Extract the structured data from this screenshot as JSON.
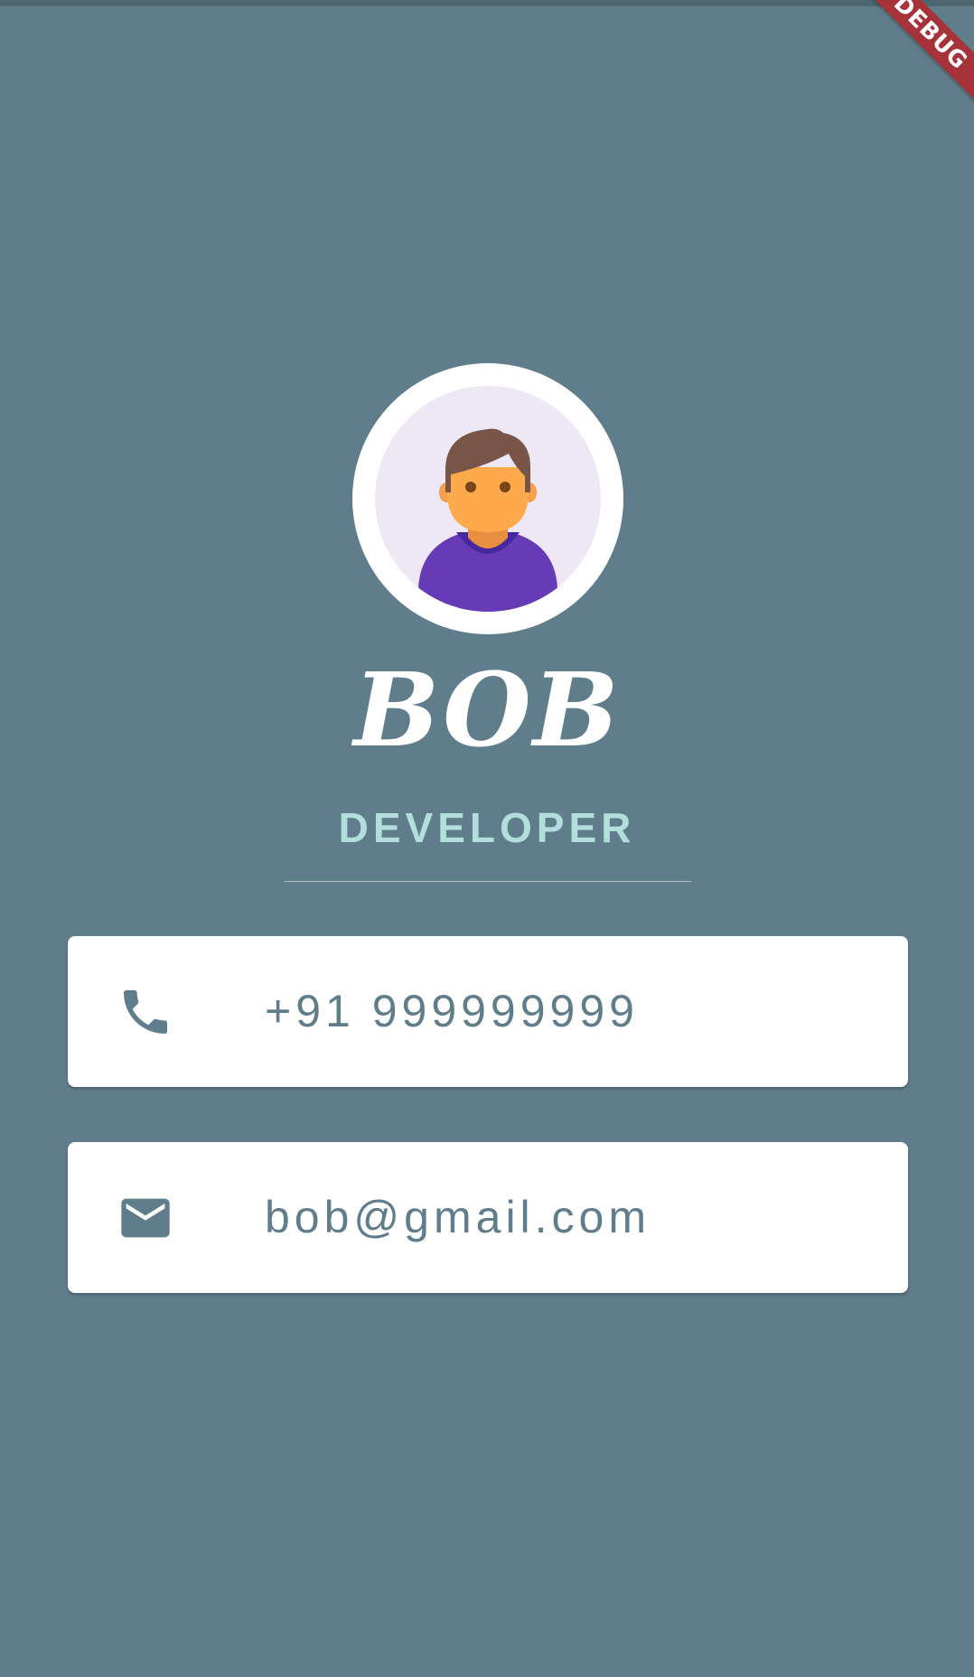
{
  "debug_banner": {
    "label": "DEBUG"
  },
  "profile": {
    "name": "BOB",
    "title": "DEVELOPER"
  },
  "contacts": {
    "phone": {
      "icon": "phone-icon",
      "value": "+91 999999999"
    },
    "email": {
      "icon": "mail-icon",
      "value": "bob@gmail.com"
    }
  },
  "colors": {
    "background": "#607D8B",
    "accent_text": "#B2DFDB",
    "card": "#FFFFFF",
    "card_text": "#607D8B",
    "debug_ribbon": "#A7333A"
  }
}
